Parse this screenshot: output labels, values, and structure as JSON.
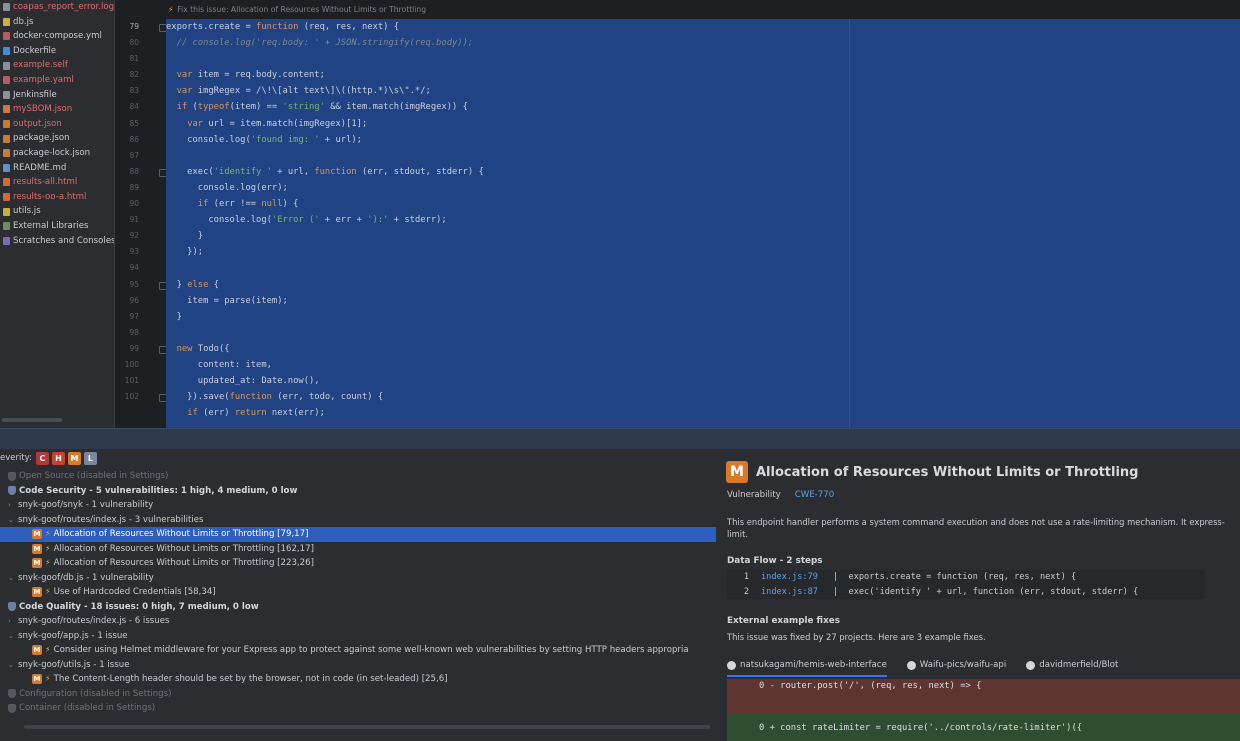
{
  "project_tree": {
    "items": [
      {
        "label": "coapas_report_error.log",
        "tone": "red",
        "icon": "file-icon"
      },
      {
        "label": "db.js",
        "tone": "normal",
        "icon": "js-file-icon"
      },
      {
        "label": "docker-compose.yml",
        "tone": "normal",
        "icon": "yaml-file-icon"
      },
      {
        "label": "Dockerfile",
        "tone": "normal",
        "icon": "docker-file-icon"
      },
      {
        "label": "example.self",
        "tone": "red",
        "icon": "file-icon"
      },
      {
        "label": "example.yaml",
        "tone": "red",
        "icon": "yaml-file-icon"
      },
      {
        "label": "Jenkinsfile",
        "tone": "normal",
        "icon": "file-icon"
      },
      {
        "label": "mySBOM.json",
        "tone": "red",
        "icon": "json-file-icon"
      },
      {
        "label": "output.json",
        "tone": "red",
        "icon": "json-file-icon"
      },
      {
        "label": "package.json",
        "tone": "normal",
        "icon": "json-file-icon"
      },
      {
        "label": "package-lock.json",
        "tone": "normal",
        "icon": "json-file-icon"
      },
      {
        "label": "README.md",
        "tone": "normal",
        "icon": "md-file-icon"
      },
      {
        "label": "results-all.html",
        "tone": "red",
        "icon": "html-file-icon"
      },
      {
        "label": "results-oo-a.html",
        "tone": "red",
        "icon": "html-file-icon"
      },
      {
        "label": "utils.js",
        "tone": "normal",
        "icon": "js-file-icon"
      },
      {
        "label": "External Libraries",
        "tone": "normal",
        "icon": "library-icon"
      },
      {
        "label": "Scratches and Consoles",
        "tone": "normal",
        "icon": "scratch-icon"
      }
    ]
  },
  "editor": {
    "hint": "Fix this issue: Allocation of Resources Without Limits or Throttling",
    "first_line_number": 79,
    "line_numbers": [
      "79",
      "80",
      "81",
      "82",
      "83",
      "84",
      "85",
      "86",
      "87",
      "88",
      "89",
      "90",
      "91",
      "92",
      "93",
      "94",
      "95",
      "96",
      "97",
      "98",
      "99",
      "100",
      "101",
      "102"
    ],
    "lines": [
      [
        {
          "t": "exports.create = ",
          "c": ""
        },
        {
          "t": "function",
          "c": "k"
        },
        {
          "t": " (req, res, next) {",
          "c": ""
        }
      ],
      [
        {
          "t": "  // console.log('req.body: ' + JSON.stringify(req.body));",
          "c": "c"
        }
      ],
      [
        {
          "t": "",
          "c": ""
        }
      ],
      [
        {
          "t": "  ",
          "c": ""
        },
        {
          "t": "var",
          "c": "k"
        },
        {
          "t": " item = req.body.content;",
          "c": ""
        }
      ],
      [
        {
          "t": "  ",
          "c": ""
        },
        {
          "t": "var",
          "c": "k"
        },
        {
          "t": " imgRegex = /\\!\\[alt text\\]\\((http.*)\\s\\\".*/;",
          "c": ""
        }
      ],
      [
        {
          "t": "  ",
          "c": ""
        },
        {
          "t": "if",
          "c": "k"
        },
        {
          "t": " (",
          "c": ""
        },
        {
          "t": "typeof",
          "c": "k"
        },
        {
          "t": "(item) == ",
          "c": ""
        },
        {
          "t": "'string'",
          "c": "s"
        },
        {
          "t": " && item.match(imgRegex)) {",
          "c": ""
        }
      ],
      [
        {
          "t": "    ",
          "c": ""
        },
        {
          "t": "var",
          "c": "k"
        },
        {
          "t": " url = item.match(imgRegex)[1];",
          "c": ""
        }
      ],
      [
        {
          "t": "    console.log(",
          "c": ""
        },
        {
          "t": "'found img: '",
          "c": "s"
        },
        {
          "t": " + url);",
          "c": ""
        }
      ],
      [
        {
          "t": "",
          "c": ""
        }
      ],
      [
        {
          "t": "    exec(",
          "c": ""
        },
        {
          "t": "'identify '",
          "c": "s"
        },
        {
          "t": " + url, ",
          "c": ""
        },
        {
          "t": "function",
          "c": "k"
        },
        {
          "t": " (err, stdout, stderr) {",
          "c": ""
        }
      ],
      [
        {
          "t": "      console.log(err);",
          "c": ""
        }
      ],
      [
        {
          "t": "      ",
          "c": ""
        },
        {
          "t": "if",
          "c": "k"
        },
        {
          "t": " (err !== ",
          "c": ""
        },
        {
          "t": "null",
          "c": "k"
        },
        {
          "t": ") {",
          "c": ""
        }
      ],
      [
        {
          "t": "        console.log(",
          "c": ""
        },
        {
          "t": "'Error ('",
          "c": "s"
        },
        {
          "t": " + err + ",
          "c": ""
        },
        {
          "t": "'):'",
          "c": "s"
        },
        {
          "t": " + stderr);",
          "c": ""
        }
      ],
      [
        {
          "t": "      }",
          "c": ""
        }
      ],
      [
        {
          "t": "    });",
          "c": ""
        }
      ],
      [
        {
          "t": "",
          "c": ""
        }
      ],
      [
        {
          "t": "  } ",
          "c": ""
        },
        {
          "t": "else",
          "c": "k"
        },
        {
          "t": " {",
          "c": ""
        }
      ],
      [
        {
          "t": "    item = parse(item);",
          "c": ""
        }
      ],
      [
        {
          "t": "  }",
          "c": ""
        }
      ],
      [
        {
          "t": "",
          "c": ""
        }
      ],
      [
        {
          "t": "  ",
          "c": ""
        },
        {
          "t": "new",
          "c": "k"
        },
        {
          "t": " Todo({",
          "c": ""
        }
      ],
      [
        {
          "t": "      content: item,",
          "c": ""
        }
      ],
      [
        {
          "t": "      updated_at: Date.now(),",
          "c": ""
        }
      ],
      [
        {
          "t": "    }).save(",
          "c": ""
        },
        {
          "t": "function",
          "c": "k"
        },
        {
          "t": " (err, todo, count) {",
          "c": ""
        }
      ],
      [
        {
          "t": "    ",
          "c": ""
        },
        {
          "t": "if",
          "c": "k"
        },
        {
          "t": " (err) ",
          "c": ""
        },
        {
          "t": "return",
          "c": "k"
        },
        {
          "t": " next(err);",
          "c": ""
        }
      ]
    ]
  },
  "issues": {
    "severity_label": "everity:",
    "severity_filters": [
      {
        "letter": "C",
        "kind": "critical"
      },
      {
        "letter": "H",
        "kind": "high"
      },
      {
        "letter": "M",
        "kind": "medium"
      },
      {
        "letter": "L",
        "kind": "low"
      }
    ],
    "rows": [
      {
        "text": "Open Source (disabled in Settings)",
        "indent": 8,
        "style": "dim",
        "icon": "shield-off"
      },
      {
        "text": "Code Security - 5 vulnerabilities: 1 high, 4 medium, 0 low",
        "indent": 8,
        "style": "bold",
        "icon": "shield"
      },
      {
        "text": "snyk-goof/snyk - 1 vulnerability",
        "indent": 8,
        "style": "",
        "icon": "chevron"
      },
      {
        "text": "snyk-goof/routes/index.js - 3 vulnerabilities",
        "indent": 8,
        "style": "",
        "icon": "chevron-open"
      },
      {
        "text": "Allocation of Resources Without Limits or Throttling [79,17]",
        "indent": 32,
        "style": "selected",
        "icon": "medium"
      },
      {
        "text": "Allocation of Resources Without Limits or Throttling [162,17]",
        "indent": 32,
        "style": "",
        "icon": "medium"
      },
      {
        "text": "Allocation of Resources Without Limits or Throttling [223,26]",
        "indent": 32,
        "style": "",
        "icon": "medium"
      },
      {
        "text": "snyk-goof/db.js - 1 vulnerability",
        "indent": 8,
        "style": "",
        "icon": "chevron-open"
      },
      {
        "text": "Use of Hardcoded Credentials [58,34]",
        "indent": 32,
        "style": "",
        "icon": "medium"
      },
      {
        "text": "Code Quality - 18 issues: 0 high, 7 medium, 0 low",
        "indent": 8,
        "style": "bold",
        "icon": "shield"
      },
      {
        "text": "snyk-goof/routes/index.js - 6 issues",
        "indent": 8,
        "style": "",
        "icon": "chevron"
      },
      {
        "text": "snyk-goof/app.js - 1 issue",
        "indent": 8,
        "style": "",
        "icon": "chevron-open"
      },
      {
        "text": "Consider using Helmet middleware for your Express app to protect against some well-known web vulnerabilities by setting HTTP headers appropria",
        "indent": 32,
        "style": "",
        "icon": "medium"
      },
      {
        "text": "snyk-goof/utils.js - 1 issue",
        "indent": 8,
        "style": "",
        "icon": "chevron-open"
      },
      {
        "text": "The Content-Length header should be set by the browser, not in code (in set-leaded) [25,6]",
        "indent": 32,
        "style": "",
        "icon": "medium"
      },
      {
        "text": "Configuration (disabled in Settings)",
        "indent": 8,
        "style": "dim",
        "icon": "shield-off"
      },
      {
        "text": "Container (disabled in Settings)",
        "indent": 8,
        "style": "dim",
        "icon": "shield-off"
      }
    ]
  },
  "details": {
    "severity_letter": "M",
    "title": "Allocation of Resources Without Limits or Throttling",
    "type": "Vulnerability",
    "cwe": "CWE-770",
    "description": "This endpoint handler performs a system command execution and does not use a rate-limiting mechanism. It express-limit.",
    "data_flow_title": "Data Flow - 2 steps",
    "data_flow": [
      {
        "n": "1",
        "loc": "index.js:79",
        "code": "|  exports.create = function (req, res, next) {"
      },
      {
        "n": "2",
        "loc": "index.js:87",
        "code": "|  exec('identify ' + url, function (err, stdout, stderr) {"
      }
    ],
    "external_title": "External example fixes",
    "external_sub": "This issue was fixed by 27 projects. Here are 3 example fixes.",
    "tabs": [
      {
        "label": "natsukagami/hemis-web-interface",
        "active": true
      },
      {
        "label": "Waifu-pics/waifu-api",
        "active": false
      },
      {
        "label": "davidmerfield/Blot",
        "active": false
      }
    ],
    "diff_removed": "0 - router.post('/', (req, res, next) => {",
    "diff_added": "0 + const rateLimiter = require('../controls/rate-limiter')({"
  }
}
